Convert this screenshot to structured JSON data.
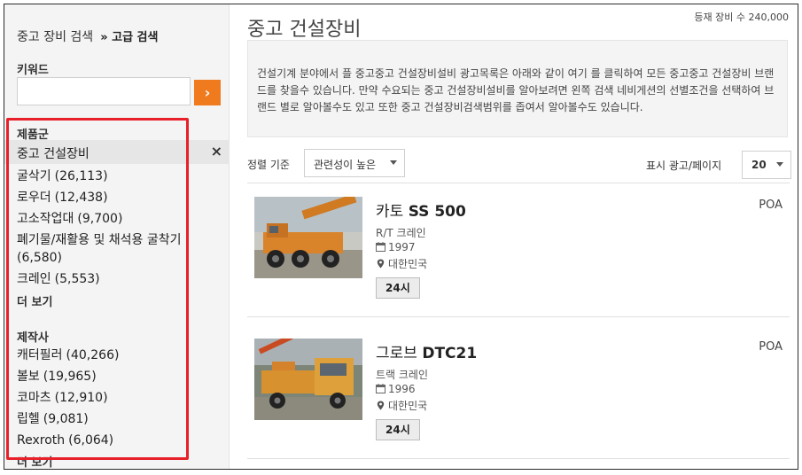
{
  "sidebar": {
    "heading": "중고 장비 검색",
    "advanced": "» 고급 검색",
    "keyword_label": "키워드",
    "keyword_value": "",
    "go_button": "›",
    "category": {
      "title": "제품군",
      "selected": "중고 건설장비",
      "remove_icon": "×",
      "items": [
        {
          "label": "굴삭기",
          "count": "(26,113)"
        },
        {
          "label": "로우더",
          "count": "(12,438)"
        },
        {
          "label": "고소작업대",
          "count": "(9,700)"
        },
        {
          "label": "폐기물/재활용 및 채석용 굴착기",
          "count": "(6,580)"
        },
        {
          "label": "크레인",
          "count": "(5,553)"
        }
      ],
      "more": "더 보기"
    },
    "maker": {
      "title": "제작사",
      "items": [
        {
          "label": "캐터필러",
          "count": "(40,266)"
        },
        {
          "label": "볼보",
          "count": "(19,965)"
        },
        {
          "label": "코마츠",
          "count": "(12,910)"
        },
        {
          "label": "립헬",
          "count": "(9,081)"
        },
        {
          "label": "Rexroth",
          "count": "(6,064)"
        }
      ],
      "more": "더 보기"
    },
    "highlight_color": "#e8202a"
  },
  "main": {
    "total_count": "등재 장비 수 240,000",
    "title": "중고 건설장비",
    "description": "건설기계 분야에서 플 중고중고 건설장비설비 광고목록은 아래와 같이 여기 를 클릭하여 모든 중고중고 건설장비 브랜드를 찾을수 있습니다. 만약 수요되는 중고 건설장비설비를 알아보려면 왼쪽 검색 네비게션의 선별조건을 선택하여 브랜드 별로 알아볼수도 있고 또한 중고 건설장비검색범위를 좁여서 알아볼수도 있습니다.",
    "sort_label": "정렬 기준",
    "sort_value": "관련성이 높은",
    "per_page_label": "표시 광고/페이지",
    "per_page_value": "20",
    "accent_color": "#f07a1e",
    "listings": [
      {
        "brand": "카토",
        "model": "SS 500",
        "type": "R/T 크레인",
        "year": "1997",
        "location": "대한민국",
        "badge": "24시",
        "price": "POA"
      },
      {
        "brand": "그로브",
        "model": "DTC21",
        "type": "트랙 크레인",
        "year": "1996",
        "location": "대한민국",
        "badge": "24시",
        "price": "POA"
      }
    ]
  }
}
